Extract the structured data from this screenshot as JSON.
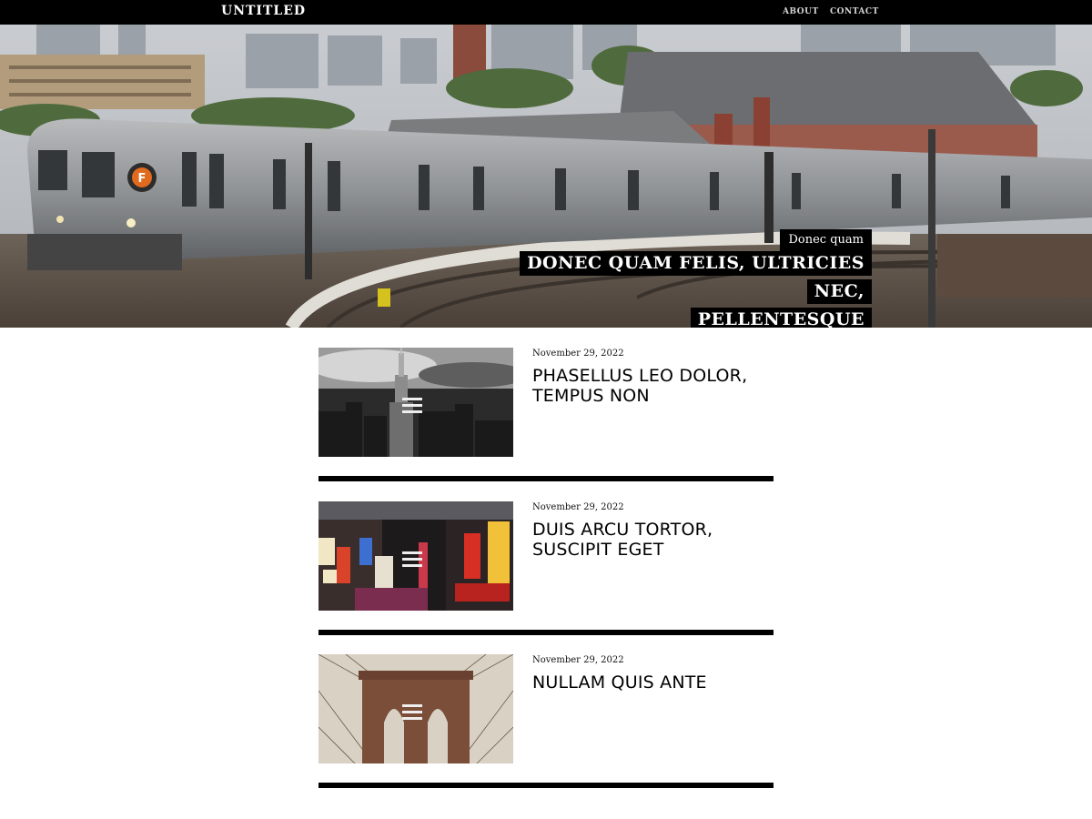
{
  "site": {
    "brand": "UNTITLED"
  },
  "nav": {
    "items": [
      {
        "label": "ABOUT"
      },
      {
        "label": "CONTACT"
      }
    ]
  },
  "hero": {
    "kicker": "Donec quam",
    "title_line1": "DONEC QUAM FELIS, ULTRICIES NEC,",
    "title_line2": "PELLENTESQUE",
    "train_badge": "F"
  },
  "posts": [
    {
      "date": "November 29, 2022",
      "title": "PHASELLUS LEO DOLOR, TEMPUS NON"
    },
    {
      "date": "November 29, 2022",
      "title": "DUIS ARCU TORTOR, SUSCIPIT EGET"
    },
    {
      "date": "November 29, 2022",
      "title": "NULLAM QUIS ANTE"
    }
  ],
  "colors": {
    "bar": "#000000",
    "background": "#ffffff",
    "nav_text": "#d4d4d4"
  }
}
